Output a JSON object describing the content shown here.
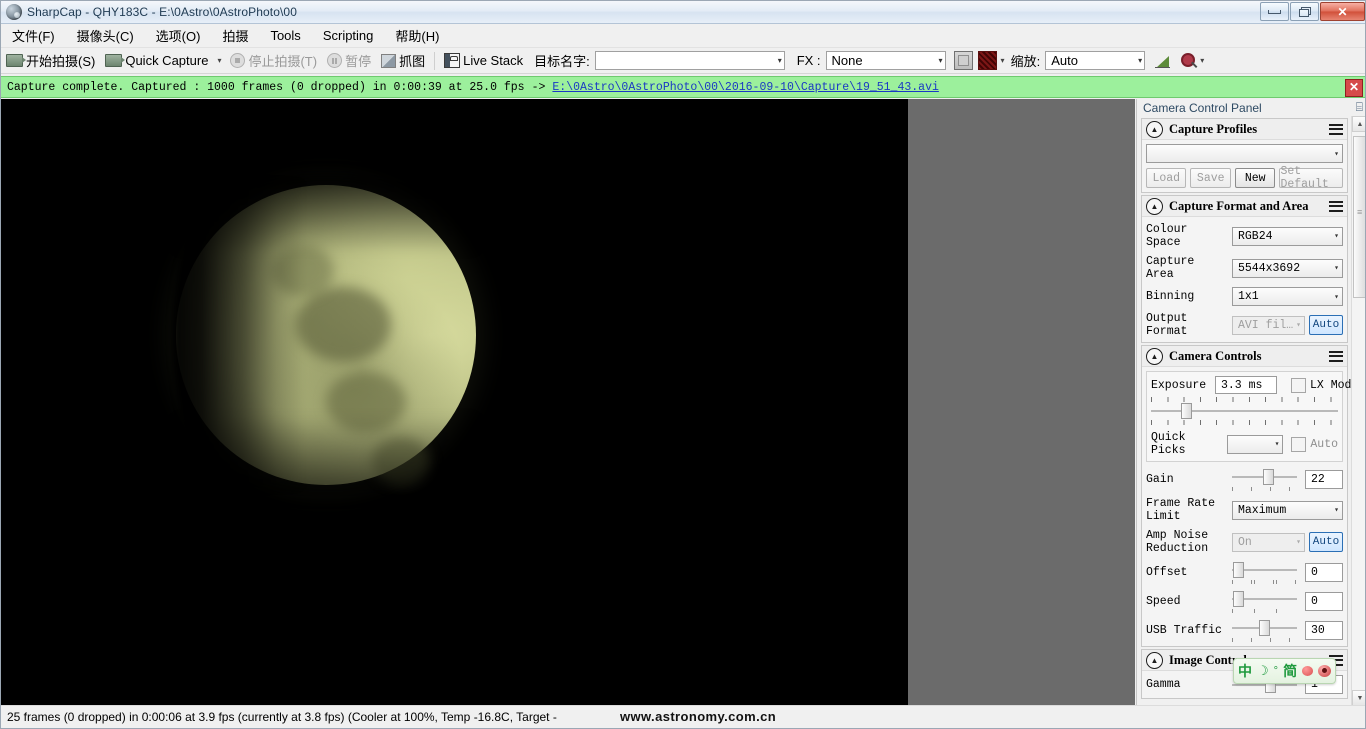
{
  "window": {
    "title": "SharpCap - QHY183C - E:\\0Astro\\0AstroPhoto\\00",
    "app_icon": "camera-globe-icon",
    "minimize_label": "",
    "restore_label": "",
    "close_label": "✕"
  },
  "menubar": {
    "items": [
      {
        "label": "文件(F)",
        "mnemonic": "F"
      },
      {
        "label": "摄像头(C)",
        "mnemonic": "C"
      },
      {
        "label": "选项(O)",
        "mnemonic": "O"
      },
      {
        "label": "拍摄",
        "mnemonic": ""
      },
      {
        "label": "Tools",
        "mnemonic": "T"
      },
      {
        "label": "Scripting",
        "mnemonic": ""
      },
      {
        "label": "帮助(H)",
        "mnemonic": "H"
      }
    ]
  },
  "toolbar": {
    "start_capture": "开始拍摄(S)",
    "quick_capture": "Quick Capture",
    "quick_capture_caret": "▾",
    "stop_capture": "停止拍摄(T)",
    "pause": "暂停",
    "snapshot": "抓图",
    "live_stack": "Live Stack",
    "target_name_label": "目标名字:",
    "target_name_value": "",
    "target_name_caret": "▾",
    "fx_label": "FX :",
    "fx_value": "None",
    "fx_caret": "▾",
    "colour_swatch_caret": "▾",
    "zoom_label": "缩放:",
    "zoom_value": "Auto",
    "zoom_caret": "▾",
    "histogram_icon": "histogram-icon",
    "magnifier_icon": "magnifier-icon",
    "magnifier_caret": "▾"
  },
  "capture_strip": {
    "message": "Capture complete.  Captured : 1000 frames (0 dropped) in 0:00:39 at 25.0 fps",
    "arrow": "->",
    "link": "E:\\0Astro\\0AstroPhoto\\00\\2016-09-10\\Capture\\19_51_43.avi",
    "close_label": "✕"
  },
  "viewport": {
    "subject": "moon-gibbous-image",
    "background_color": "#6b6b6b",
    "image_background": "#000000"
  },
  "panel": {
    "title": "Camera Control Panel",
    "pin_icon": "pin-icon",
    "groups": [
      {
        "title": "Capture Profiles",
        "collapse_icon": "chevron-up-icon",
        "menu_icon": "hamburger-icon",
        "profile_value": "",
        "profile_caret": "▾",
        "buttons": [
          {
            "label": "Load",
            "enabled": false
          },
          {
            "label": "Save",
            "enabled": false
          },
          {
            "label": "New",
            "enabled": true
          },
          {
            "label": "Set Default",
            "enabled": false
          }
        ]
      },
      {
        "title": "Capture Format and Area",
        "collapse_icon": "chevron-up-icon",
        "menu_icon": "hamburger-icon",
        "rows": [
          {
            "label": "Colour Space",
            "value": "RGB24",
            "type": "combo"
          },
          {
            "label": "Capture Area",
            "value": "5544x3692",
            "type": "combo"
          },
          {
            "label": "Binning",
            "value": "1x1",
            "type": "combo"
          },
          {
            "label": "Output Format",
            "value": "AVI fil…",
            "type": "combo-disabled",
            "auto": "Auto"
          }
        ]
      },
      {
        "title": "Camera Controls",
        "collapse_icon": "chevron-up-icon",
        "menu_icon": "hamburger-icon",
        "exposure_label": "Exposure",
        "exposure_value": "3.3 ms",
        "lx_mode_label": "LX Mode",
        "lx_mode_checked": false,
        "quick_picks_label": "Quick Picks",
        "quick_picks_value": "",
        "quick_picks_auto_label": "Auto",
        "quick_picks_auto_checked": false,
        "rows": [
          {
            "label": "Gain",
            "value": "22",
            "type": "slider",
            "pos": 48
          },
          {
            "label": "Frame Rate Limit",
            "value": "Maximum",
            "type": "combo"
          },
          {
            "label": "Amp Noise Reduction",
            "value": "On",
            "type": "combo-disabled",
            "auto": "Auto"
          },
          {
            "label": "Offset",
            "value": "0",
            "type": "slider",
            "pos": 2
          },
          {
            "label": "Speed",
            "value": "0",
            "type": "slider",
            "pos": 2
          },
          {
            "label": "USB Traffic",
            "value": "30",
            "type": "slider",
            "pos": 44
          }
        ]
      },
      {
        "title": "Image Controls",
        "collapse_icon": "chevron-up-icon",
        "menu_icon": "hamburger-icon",
        "rows": [
          {
            "label": "Gamma",
            "value": "1",
            "type": "slider",
            "pos": 50
          }
        ]
      }
    ],
    "scrollbar": {
      "up_arrow": "▲",
      "down_arrow": "▼"
    }
  },
  "ime": {
    "mode_label": "中",
    "moon_icon": "moon-icon",
    "punctuation_label": "°",
    "script_label": "简",
    "dot1_icon": "red-dot-icon",
    "dot2_icon": "red-target-icon"
  },
  "statusbar": {
    "text": "25 frames (0 dropped) in 0:00:06 at 3.9 fps  (currently at 3.8 fps) (Cooler at 100%, Temp -16.8C, Target -",
    "watermark": "www.astronomy.com.cn"
  }
}
